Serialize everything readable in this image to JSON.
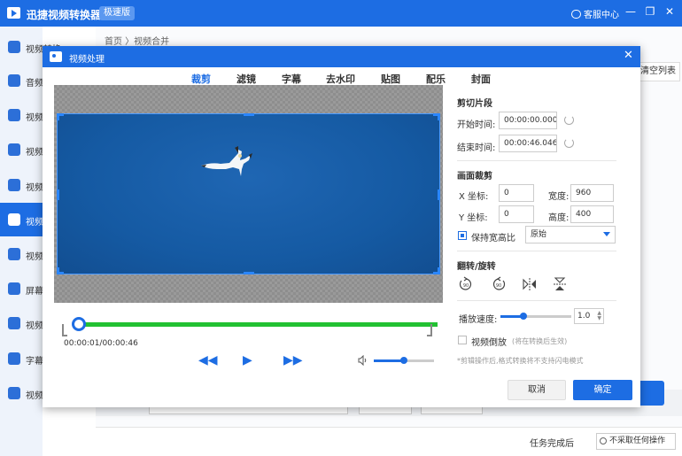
{
  "app": {
    "name": "迅捷视频转换器",
    "edition": "极速版",
    "service_label": "客服中心",
    "minimize_glyph": "—",
    "restore_glyph": "❐",
    "close_glyph": "✕"
  },
  "sidebar": {
    "items": [
      {
        "label": "视频转换",
        "icon": "video-convert-icon"
      },
      {
        "label": "音频",
        "icon": "audio-icon"
      },
      {
        "label": "视频",
        "icon": "video-icon"
      },
      {
        "label": "视频",
        "icon": "video-icon"
      },
      {
        "label": "视频",
        "icon": "video-icon"
      },
      {
        "label": "视频",
        "icon": "video-icon"
      },
      {
        "label": "视频",
        "icon": "video-icon"
      },
      {
        "label": "屏幕",
        "icon": "screen-icon"
      },
      {
        "label": "视频",
        "icon": "video-icon"
      },
      {
        "label": "字幕",
        "icon": "subtitle-icon"
      },
      {
        "label": "视频",
        "icon": "video-icon"
      }
    ],
    "active_index": 5
  },
  "breadcrumb": "首页 〉视频合并",
  "background": {
    "list_button": "清空列表",
    "task_done_label": "任务完成后",
    "task_done_value": "不采取任何操作"
  },
  "modal": {
    "title": "视频处理",
    "close_glyph": "✕",
    "tabs": [
      "裁剪",
      "滤镜",
      "字幕",
      "去水印",
      "贴图",
      "配乐",
      "封面"
    ],
    "active_tab": 0,
    "player": {
      "time": "00:00:01/00:00:46",
      "progress_fraction": 0.02,
      "volume_fraction": 0.5,
      "rewind_glyph": "◀◀",
      "play_glyph": "▶",
      "forward_glyph": "▶▶"
    },
    "clip": {
      "section_title": "剪切片段",
      "start_label": "开始时间:",
      "start_value": "00:00:00.000",
      "end_label": "结束时间:",
      "end_value": "00:00:46.046"
    },
    "crop": {
      "section_title": "画面裁剪",
      "x_label": "X 坐标:",
      "x_value": "0",
      "y_label": "Y 坐标:",
      "y_value": "0",
      "width_label": "宽度:",
      "width_value": "960",
      "height_label": "高度:",
      "height_value": "400",
      "keep_ratio_label": "保持宽高比",
      "keep_ratio_checked": true,
      "ratio_value": "原始"
    },
    "flip": {
      "section_title": "翻转/旋转",
      "buttons": [
        "rotate-left-90-icon",
        "rotate-right-90-icon",
        "flip-horizontal-icon",
        "flip-vertical-icon"
      ],
      "rotate_left_text": "90",
      "rotate_right_text": "90"
    },
    "speed": {
      "label": "播放速度:",
      "value": "1.0",
      "fraction": 0.33
    },
    "reverse": {
      "label": "视频倒放",
      "note": "(将在转换后生效)",
      "checked": false
    },
    "tip": "*剪辑操作后,格式转换将不支持闪电模式",
    "cancel_label": "取消",
    "ok_label": "确定"
  },
  "colors": {
    "accent": "#1d6de3",
    "progress": "#22c132",
    "video_bg": "#155aa3"
  }
}
